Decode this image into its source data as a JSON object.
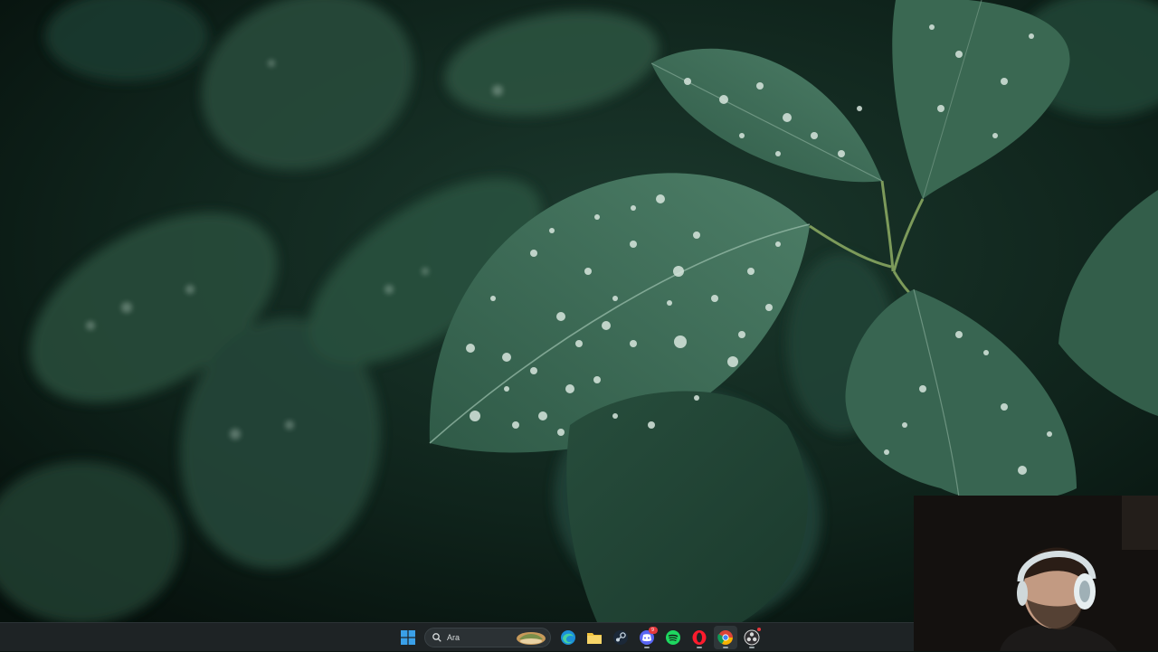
{
  "desktop": {
    "wallpaper": "green-leaves-with-water-droplets"
  },
  "taskbar": {
    "search_placeholder": "Ara",
    "icons": [
      {
        "name": "start-windows-icon"
      },
      {
        "name": "search-icon"
      },
      {
        "name": "edge-icon"
      },
      {
        "name": "file-explorer-icon"
      },
      {
        "name": "steam-icon"
      },
      {
        "name": "discord-icon",
        "badge": "9"
      },
      {
        "name": "spotify-icon"
      },
      {
        "name": "opera-icon"
      },
      {
        "name": "chrome-icon"
      },
      {
        "name": "obs-icon"
      }
    ],
    "discord_badge": "9"
  },
  "overlay": {
    "webcam": "streamer-webcam"
  },
  "colors": {
    "taskbar_bg": "#1e2325",
    "leaf": "#3d6b56",
    "accent_windows": "#3aa0e8"
  }
}
